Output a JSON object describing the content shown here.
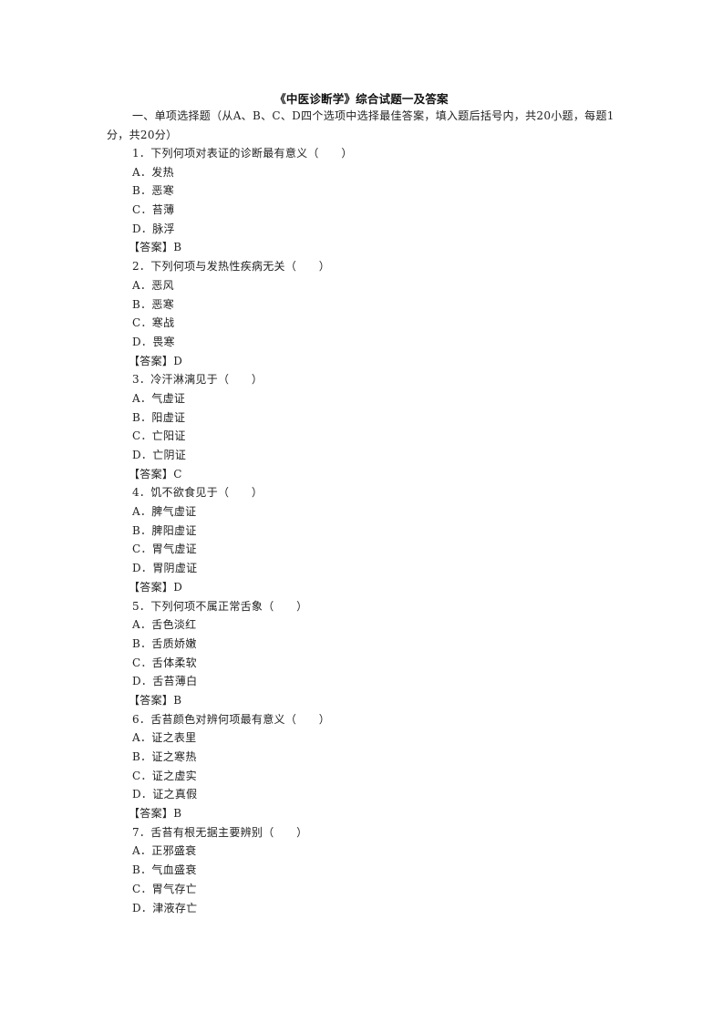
{
  "document": {
    "title": "《中医诊断学》综合试题一及答案",
    "section_intro": "一、单项选择题（从A、B、C、D四个选项中选择最佳答案，填入题后括号内，共20小题，每题1分，共20分）",
    "answer_prefix": "【答案】",
    "questions": [
      {
        "stem": "1．下列何项对表证的诊断最有意义（　　）",
        "options": [
          "A．发热",
          "B．恶寒",
          "C．苔薄",
          "D．脉浮"
        ],
        "answer": "【答案】B"
      },
      {
        "stem": "2．下列何项与发热性疾病无关（　　）",
        "options": [
          "A．恶风",
          "B．恶寒",
          "C．寒战",
          "D．畏寒"
        ],
        "answer": "【答案】D"
      },
      {
        "stem": "3．冷汗淋漓见于（　　）",
        "options": [
          "A．气虚证",
          "B．阳虚证",
          "C．亡阳证",
          "D．亡阴证"
        ],
        "answer": "【答案】C"
      },
      {
        "stem": "4．饥不欲食见于（　　）",
        "options": [
          "A．脾气虚证",
          "B．脾阳虚证",
          "C．胃气虚证",
          "D．胃阴虚证"
        ],
        "answer": "【答案】D"
      },
      {
        "stem": "5．下列何项不属正常舌象（　　）",
        "options": [
          "A．舌色淡红",
          "B．舌质娇嫩",
          "C．舌体柔软",
          "D．舌苔薄白"
        ],
        "answer": "【答案】B"
      },
      {
        "stem": "6．舌苔颜色对辨何项最有意义（　　）",
        "options": [
          "A．证之表里",
          "B．证之寒热",
          "C．证之虚实",
          "D．证之真假"
        ],
        "answer": "【答案】B"
      },
      {
        "stem": "7．舌苔有根无据主要辨别（　　）",
        "options": [
          "A．正邪盛衰",
          "B．气血盛衰",
          "C．胃气存亡",
          "D．津液存亡"
        ],
        "answer": null
      }
    ]
  }
}
